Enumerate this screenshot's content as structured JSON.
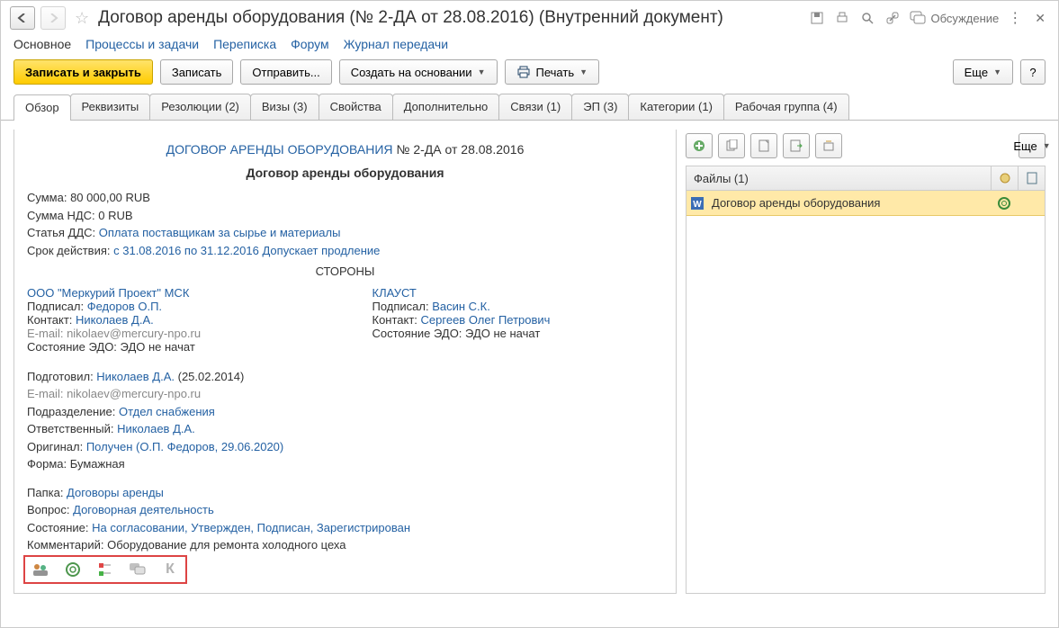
{
  "header": {
    "title": "Договор аренды оборудования (№ 2-ДА от 28.08.2016) (Внутренний документ)",
    "discuss": "Обсуждение"
  },
  "nav": {
    "main": "Основное",
    "proc": "Процессы и задачи",
    "corr": "Переписка",
    "forum": "Форум",
    "journal": "Журнал передачи"
  },
  "toolbar": {
    "save_close": "Записать и закрыть",
    "save": "Записать",
    "send": "Отправить...",
    "create": "Создать на основании",
    "print": "Печать",
    "more": "Еще",
    "help": "?"
  },
  "tabs": {
    "overview": "Обзор",
    "req": "Реквизиты",
    "res": "Резолюции (2)",
    "visas": "Визы (3)",
    "props": "Свойства",
    "extra": "Дополнительно",
    "links": "Связи (1)",
    "ep": "ЭП (3)",
    "cat": "Категории (1)",
    "group": "Рабочая группа (4)"
  },
  "doc": {
    "title_link": "ДОГОВОР АРЕНДЫ ОБОРУДОВАНИЯ",
    "title_suffix": " № 2-ДА от 28.08.2016",
    "subtitle": "Договор аренды оборудования",
    "sum_lbl": "Сумма: ",
    "sum_val": "80 000,00 RUB",
    "nds_lbl": "Сумма НДС: ",
    "nds_val": "0 RUB",
    "dds_lbl": "Статья ДДС: ",
    "dds_link": "Оплата поставщикам за сырье и материалы",
    "period_lbl": "Срок действия: ",
    "period_link": "с 31.08.2016 по 31.12.2016 Допускает продление",
    "parties_title": "СТОРОНЫ",
    "party1": {
      "name": "ООО \"Меркурий Проект\" МСК",
      "signed_lbl": "Подписал: ",
      "signed": "Федоров О.П.",
      "contact_lbl": "Контакт: ",
      "contact": "Николаев Д.А.",
      "email_lbl": "E-mail: ",
      "email": "nikolaev@mercury-npo.ru",
      "edo_lbl": "Состояние ЭДО: ",
      "edo": "ЭДО не начат"
    },
    "party2": {
      "name": "КЛАУСТ",
      "signed_lbl": "Подписал: ",
      "signed": "Васин С.К.",
      "contact_lbl": "Контакт: ",
      "contact": "Сергеев Олег Петрович",
      "edo_lbl": "Состояние ЭДО: ",
      "edo": "ЭДО не начат"
    },
    "prep_lbl": "Подготовил: ",
    "prep_link": "Николаев Д.А.",
    "prep_date": " (25.02.2014)",
    "prep_email_lbl": "E-mail: ",
    "prep_email": "nikolaev@mercury-npo.ru",
    "dept_lbl": "Подразделение: ",
    "dept": "Отдел снабжения",
    "resp_lbl": "Ответственный: ",
    "resp": "Николаев Д.А.",
    "orig_lbl": "Оригинал: ",
    "orig": "Получен (О.П. Федоров, 29.06.2020)",
    "form_lbl": "Форма: ",
    "form": "Бумажная",
    "folder_lbl": "Папка: ",
    "folder": "Договоры аренды",
    "question_lbl": "Вопрос: ",
    "question": "Договорная деятельность",
    "state_lbl": "Состояние: ",
    "state": "На согласовании, Утвержден, Подписан, Зарегистрирован",
    "comment_lbl": "Комментарий: ",
    "comment": "Оборудование для ремонта холодного цеха"
  },
  "files": {
    "header": "Файлы (1)",
    "row1": "Договор аренды оборудования",
    "more": "Еще"
  },
  "statusbar": {
    "k": "К"
  }
}
